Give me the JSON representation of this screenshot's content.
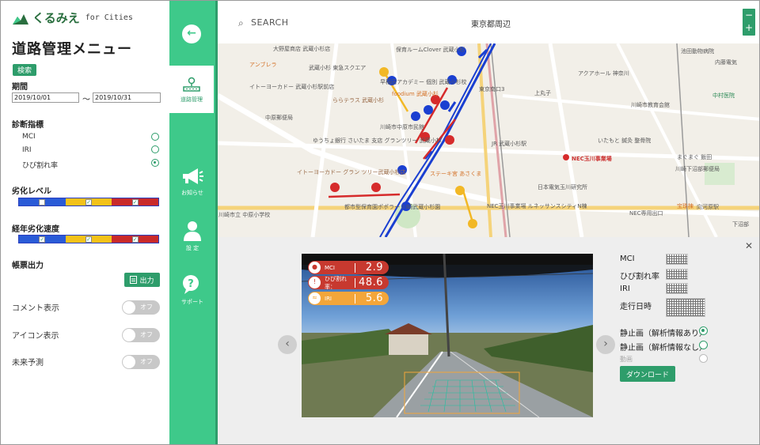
{
  "app": {
    "logo_text": "くるみえ",
    "logo_sub": "for Cities",
    "page_title": "道路管理メニュー"
  },
  "filters": {
    "search_label": "検索",
    "period_label": "期間",
    "date_from": "2019/10/01",
    "date_sep": "～",
    "date_to": "2019/10/31",
    "diagnosis_label": "診断指標",
    "indicators": [
      {
        "label": "MCI",
        "selected": false
      },
      {
        "label": "IRI",
        "selected": false
      },
      {
        "label": "ひび割れ率",
        "selected": true
      }
    ],
    "degradation_label": "劣化レベル",
    "degradation_checks": [
      false,
      true,
      true
    ],
    "aging_label": "経年劣化速度",
    "aging_checks": [
      true,
      true,
      true
    ],
    "report_label": "帳票出力",
    "output_button": "出力",
    "toggles": [
      {
        "label": "コメント表示",
        "state": "オフ"
      },
      {
        "label": "アイコン表示",
        "state": "オフ"
      },
      {
        "label": "未来予測",
        "state": "オフ"
      }
    ],
    "colors": {
      "blue": "#2a5bd7",
      "yellow": "#f4c21a",
      "red": "#c92a2a",
      "accent": "#3ec98a"
    }
  },
  "nav": {
    "back_icon": "arrow-left-icon",
    "items": [
      {
        "label": "道路管理",
        "icon": "road-icon",
        "active": true
      },
      {
        "label": "お知らせ",
        "icon": "megaphone-icon",
        "active": false
      },
      {
        "label": "設 定",
        "icon": "user-icon",
        "active": false
      },
      {
        "label": "サポート",
        "icon": "question-icon",
        "active": false
      }
    ]
  },
  "map": {
    "search_placeholder": "SEARCH",
    "location": "東京都周辺",
    "zoom_in": "+",
    "zoom_out": "−",
    "places": [
      "大野屋商店 武蔵小杉店",
      "アンブレラ",
      "イトーヨーカドー 武蔵小杉駅前店",
      "保育ルームClover 武蔵小杉",
      "武蔵小杉 東急スクエア",
      "早稲田アカデミー 個別 武蔵小杉校",
      "foodium 武蔵小杉",
      "ららテラス 武蔵小杉",
      "川崎市中原市民館",
      "中原郵便局",
      "ゆうちょ銀行 さいたま 支店 グランツリー 武蔵小杉",
      "イトーヨーカドー グラン ツリー武蔵小杉店",
      "ステーキ宮 あさくま",
      "都市型保育園ポポラー 川崎武蔵小杉園",
      "NEC玉川事業場",
      "日本電気玉川研究所",
      "NEC玉川事業場 ルネッサンスシティN棟",
      "JR 武蔵小杉駅",
      "上丸子",
      "アクアホール 神奈川",
      "川崎市教育会館",
      "池田動物病院",
      "内藤電気",
      "中村医院",
      "いたもと 鍼灸 整骨院",
      "まぐまぐ 飯田",
      "川崎下沼部郵便局",
      "宝珠棟",
      "向河原駅",
      "NEC専用出口",
      "下沼部",
      "東京南口3",
      "川崎市立 中原小学校"
    ]
  },
  "detail": {
    "metrics": [
      {
        "label": "MCI",
        "value": "2.9",
        "icon": "pin-icon"
      },
      {
        "label": "ひび割れ率：",
        "value": "48.6",
        "icon": "alert-icon"
      },
      {
        "label": "IRI",
        "value": "5.6",
        "icon": "vibration-icon"
      }
    ],
    "info_labels": [
      "MCI",
      "ひび割れ率",
      "IRI",
      "走行日時"
    ],
    "options": [
      {
        "label": "静止画（解析情報あり）",
        "selected": true,
        "enabled": true
      },
      {
        "label": "静止画（解析情報なし）",
        "selected": false,
        "enabled": true
      },
      {
        "label": "動画",
        "selected": false,
        "enabled": false
      }
    ],
    "download_button": "ダウンロード",
    "close_icon": "close-icon",
    "prev_icon": "chevron-left-icon",
    "next_icon": "chevron-right-icon"
  }
}
